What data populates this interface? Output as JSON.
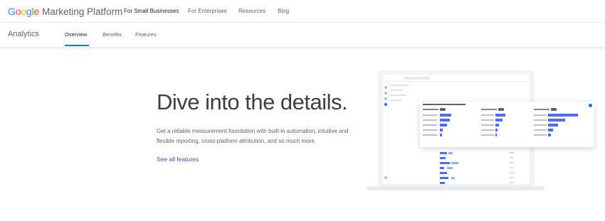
{
  "brand": {
    "google": "Google",
    "platform": "Marketing Platform",
    "colors": [
      "#4285f4",
      "#ea4335",
      "#fbbc05",
      "#4285f4",
      "#34a853",
      "#ea4335"
    ]
  },
  "topnav": {
    "items": [
      "For Small Businesses",
      "For Enterprises",
      "Resources",
      "Blog"
    ],
    "active_index": 0
  },
  "subnav": {
    "product": "Analytics",
    "tabs": [
      "Overview",
      "Benefits",
      "Features"
    ],
    "active_index": 0,
    "accent": "#1a73e8"
  },
  "hero": {
    "title": "Dive into the details.",
    "description": "Get a reliable measurement foundation with built-in automation, intuitive and flexible reporting, cross-platform attribution, and so much more.",
    "link": "See all features",
    "link_color": "#6d2fad"
  }
}
